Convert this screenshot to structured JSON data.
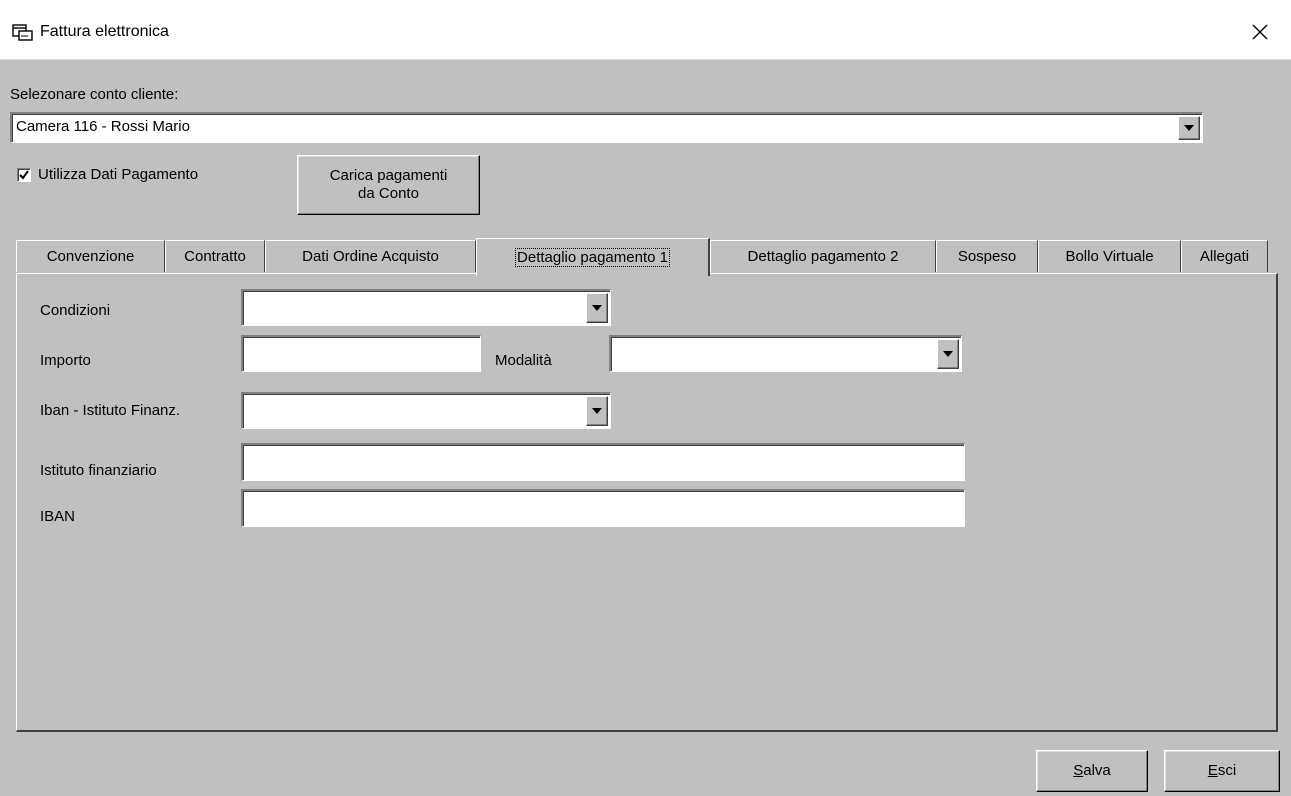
{
  "window": {
    "title": "Fattura elettronica",
    "icon": "window-app-icon",
    "close_icon": "close-icon"
  },
  "cliente": {
    "label": "Selezonare conto cliente:",
    "selected": "Camera 116 - Rossi Mario"
  },
  "pagamento": {
    "checkbox_label": "Utilizza Dati Pagamento",
    "checked": true,
    "load_button_line1": "Carica pagamenti",
    "load_button_line2": "da Conto"
  },
  "tabs": [
    {
      "label": "Convenzione"
    },
    {
      "label": "Contratto"
    },
    {
      "label": "Dati Ordine Acquisto"
    },
    {
      "label": "Dettaglio pagamento 1"
    },
    {
      "label": "Dettaglio pagamento 2"
    },
    {
      "label": "Sospeso"
    },
    {
      "label": "Bollo Virtuale"
    },
    {
      "label": "Allegati"
    }
  ],
  "active_tab": "Dettaglio pagamento 1",
  "form": {
    "condizioni_label": "Condizioni",
    "condizioni_value": "",
    "importo_label": "Importo",
    "importo_value": "",
    "modalita_label": "Modalità",
    "modalita_value": "",
    "iban_istituto_label": "Iban - Istituto Finanz.",
    "iban_istituto_value": "",
    "istituto_label": "Istituto finanziario",
    "istituto_value": "",
    "iban_label": "IBAN",
    "iban_value": ""
  },
  "footer": {
    "save_key": "S",
    "save_rest": "alva",
    "exit_key": "E",
    "exit_rest": "sci"
  }
}
